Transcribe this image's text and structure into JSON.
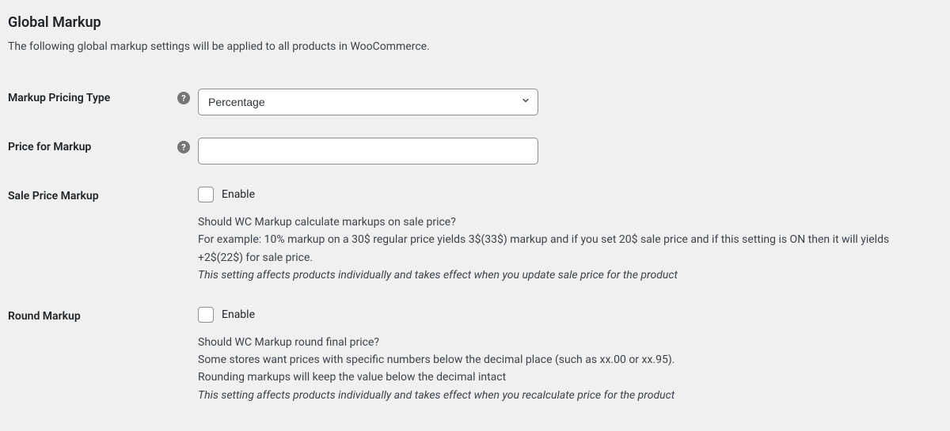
{
  "section": {
    "title": "Global Markup",
    "intro": "The following global markup settings will be applied to all products in WooCommerce."
  },
  "fields": {
    "pricing_type": {
      "label": "Markup Pricing Type",
      "selected": "Percentage"
    },
    "price_for_markup": {
      "label": "Price for Markup",
      "value": ""
    },
    "sale_price_markup": {
      "label": "Sale Price Markup",
      "checkbox_label": "Enable",
      "desc_q": "Should WC Markup calculate markups on sale price?",
      "desc_ex": "For example: 10% markup on a 30$ regular price yields 3$(33$) markup and if you set 20$ sale price and if this setting is ON then it will yields +2$(22$) for sale price.",
      "desc_note": "This setting affects products individually and takes effect when you update sale price for the product"
    },
    "round_markup": {
      "label": "Round Markup",
      "checkbox_label": "Enable",
      "desc_q": "Should WC Markup round final price?",
      "desc_l1": "Some stores want prices with specific numbers below the decimal place (such as xx.00 or xx.95).",
      "desc_l2": "Rounding markups will keep the value below the decimal intact",
      "desc_note": "This setting affects products individually and takes effect when you recalculate price for the product"
    }
  }
}
